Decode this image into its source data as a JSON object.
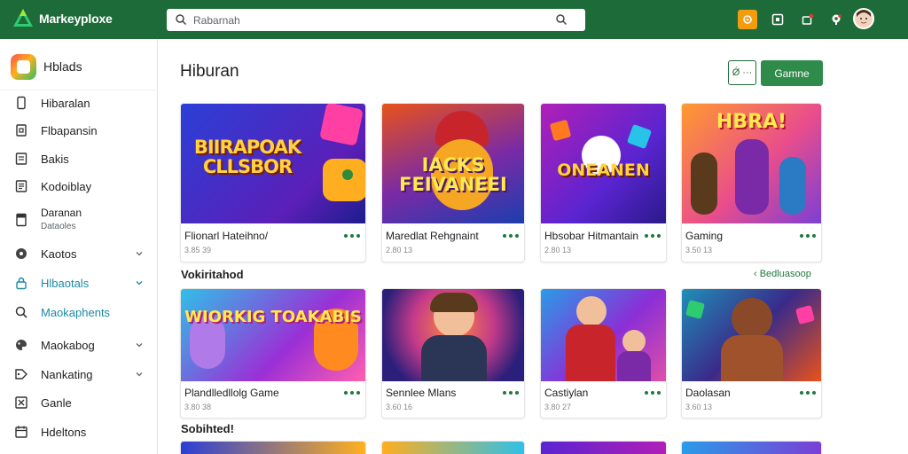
{
  "header": {
    "brand": "Markeyploxe",
    "search_placeholder": "Rabarnah"
  },
  "sidebar": {
    "app_label": "Hblads",
    "items": [
      {
        "label": "Hibaralan",
        "icon": "phone-icon"
      },
      {
        "label": "Flbapansin",
        "icon": "file-icon"
      },
      {
        "label": "Bakis",
        "icon": "list-icon"
      },
      {
        "label": "Kodoiblay",
        "icon": "document-icon"
      },
      {
        "label": "Daranan",
        "sub": "Dataoles",
        "icon": "tablet-icon"
      },
      {
        "label": "Kaotos",
        "icon": "compass-icon"
      },
      {
        "label": "Hlbaotals",
        "icon": "lock-icon"
      },
      {
        "label": "Maokaphents",
        "icon": "search-icon"
      },
      {
        "label": "Maokabog",
        "icon": "palette-icon"
      },
      {
        "label": "Nankating",
        "icon": "tag-icon"
      },
      {
        "label": "Ganle",
        "icon": "close-box-icon"
      },
      {
        "label": "Hdeltons",
        "icon": "calendar-icon"
      }
    ]
  },
  "main": {
    "title": "Hiburan",
    "outline_button": "Ǿ ···",
    "primary_button": "Gamne",
    "sections": [
      {
        "label": "Vokiritahod",
        "see_more": "‹ Bedluasoop"
      },
      {
        "label": "Sobihted!"
      }
    ],
    "row1": [
      {
        "title": "Flionarl Hateihno/",
        "meta": "3.85 39",
        "art": "BIIRAPOAK CLLSBOR"
      },
      {
        "title": "Maredlat Rehgnaint",
        "meta": "2.80 13",
        "art": "IACKS FEIVANEEI"
      },
      {
        "title": "Hbsobar Hitmantain",
        "meta": "2.80 13",
        "art": "ONEANEN"
      },
      {
        "title": "Gaming",
        "meta": "3.50 13",
        "art": "HBRA!"
      }
    ],
    "row2": [
      {
        "title": "Plandlledllolg Game",
        "meta": "3.80 38",
        "art": "WIORKIG TOAKABIS"
      },
      {
        "title": "Sennlee Mlans",
        "meta": "3.60 16",
        "art": ""
      },
      {
        "title": "Castiylan",
        "meta": "3.80 27",
        "art": ""
      },
      {
        "title": "Daolasan",
        "meta": "3.60 13",
        "art": ""
      }
    ]
  },
  "colors": {
    "topbar": "#1e6b3a",
    "accent": "#2e8b4a",
    "active_nav": "#1a8aa6"
  }
}
